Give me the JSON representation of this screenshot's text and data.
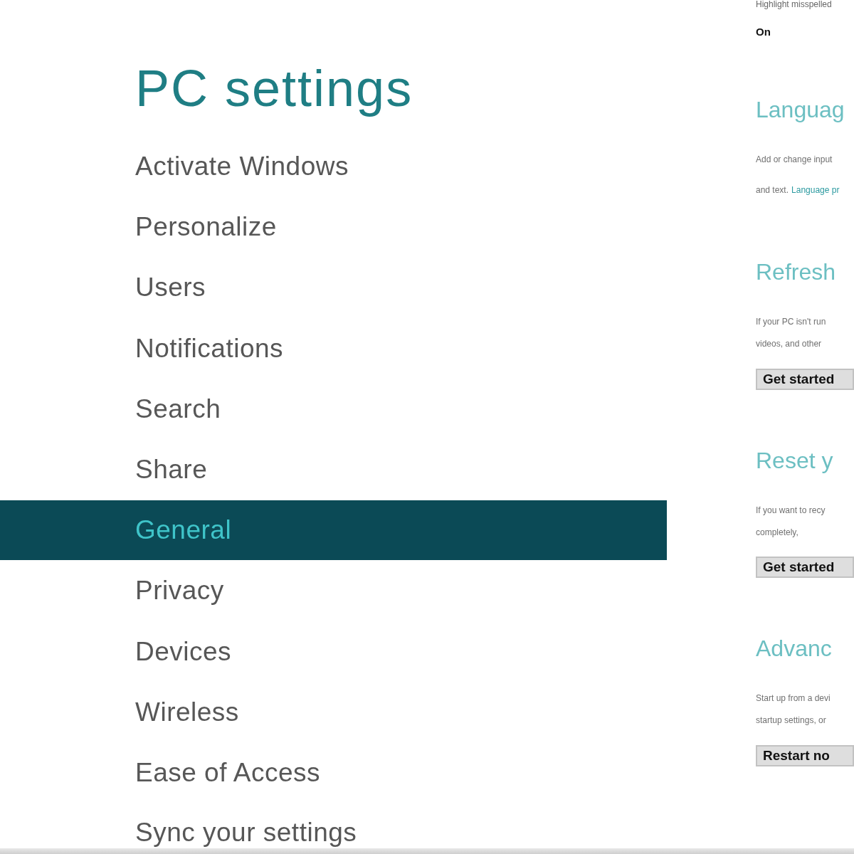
{
  "window": {
    "title": "PC settings"
  },
  "nav": {
    "items": [
      {
        "label": "Activate Windows",
        "selected": false
      },
      {
        "label": "Personalize",
        "selected": false
      },
      {
        "label": "Users",
        "selected": false
      },
      {
        "label": "Notifications",
        "selected": false
      },
      {
        "label": "Search",
        "selected": false
      },
      {
        "label": "Share",
        "selected": false
      },
      {
        "label": "General",
        "selected": true
      },
      {
        "label": "Privacy",
        "selected": false
      },
      {
        "label": "Devices",
        "selected": false
      },
      {
        "label": "Wireless",
        "selected": false
      },
      {
        "label": "Ease of Access",
        "selected": false
      },
      {
        "label": "Sync your settings",
        "selected": false
      }
    ]
  },
  "detail": {
    "top_line": "Highlight misspelled",
    "toggle": {
      "label": "On"
    },
    "sections": [
      {
        "heading": "Languag",
        "lines": [
          "Add or change input"
        ],
        "link": {
          "prefix": "and text.",
          "label": "Language pr"
        }
      },
      {
        "heading": "Refresh",
        "lines": [
          "If your PC isn't run",
          "videos, and other"
        ],
        "button": "Get started"
      },
      {
        "heading": "Reset y",
        "lines": [
          "If you want to recy",
          "completely,"
        ],
        "button": "Get started"
      },
      {
        "heading": "Advanc",
        "lines": [
          "Start up from a devi",
          "startup settings, or"
        ],
        "button": "Restart no"
      }
    ]
  }
}
